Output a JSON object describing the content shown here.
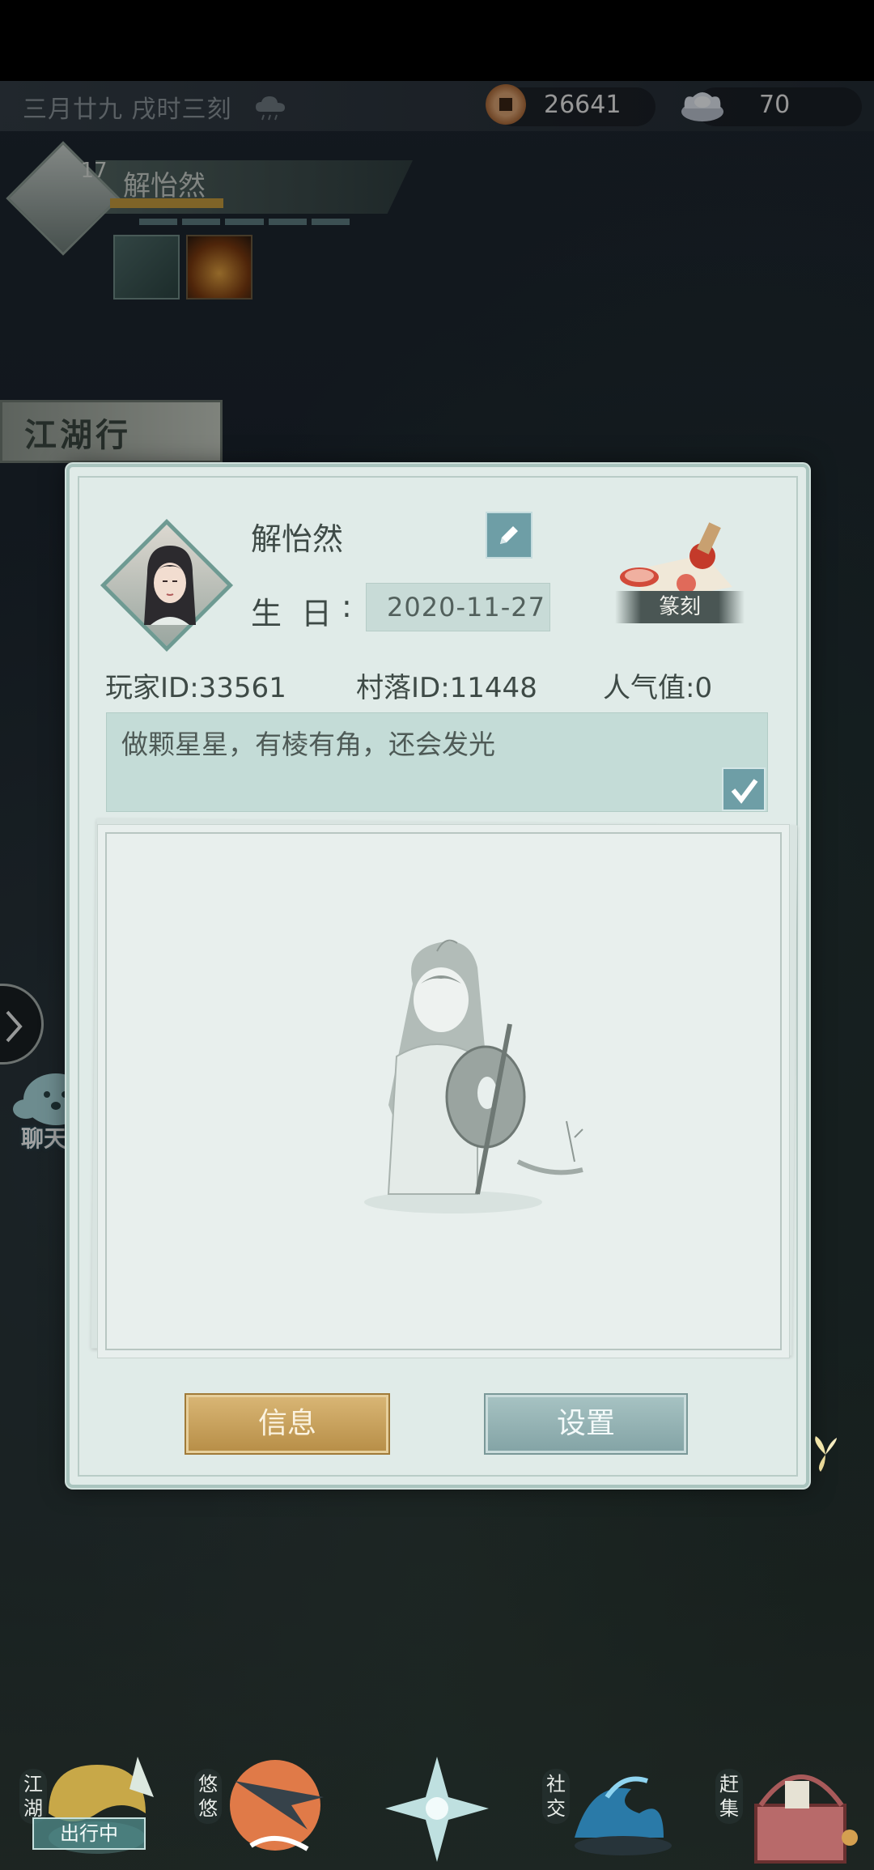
{
  "topbar": {
    "date": "三月廿九 戌时三刻",
    "weather_icon": "cloud-rain-icon",
    "copper": "26641",
    "silver": "70"
  },
  "hero": {
    "level": "17",
    "name": "解怡然"
  },
  "banner": {
    "label": "江湖行"
  },
  "chat": {
    "label": "聊天"
  },
  "profile": {
    "name": "解怡然",
    "birthday_label": "生日",
    "birthday_colon": ":",
    "birthday": "2020-11-27",
    "stamp_label": "篆刻",
    "player_id": "玩家ID:33561",
    "village_id": "村落ID:11448",
    "popularity": "人气值:0",
    "signature": "做颗星星，有棱有角，还会发光"
  },
  "buttons": {
    "info": "信息",
    "settings": "设置"
  },
  "nav": {
    "jianghu": "江湖",
    "traveling": "出行中",
    "youyou": "悠悠",
    "social": "社交",
    "market": "赶集"
  },
  "colors": {
    "dialog_bg": "#e0ebe8",
    "accent_teal": "#6e9ea6",
    "info_gold": "#c9a35c",
    "settings_teal": "#94b2b4"
  }
}
